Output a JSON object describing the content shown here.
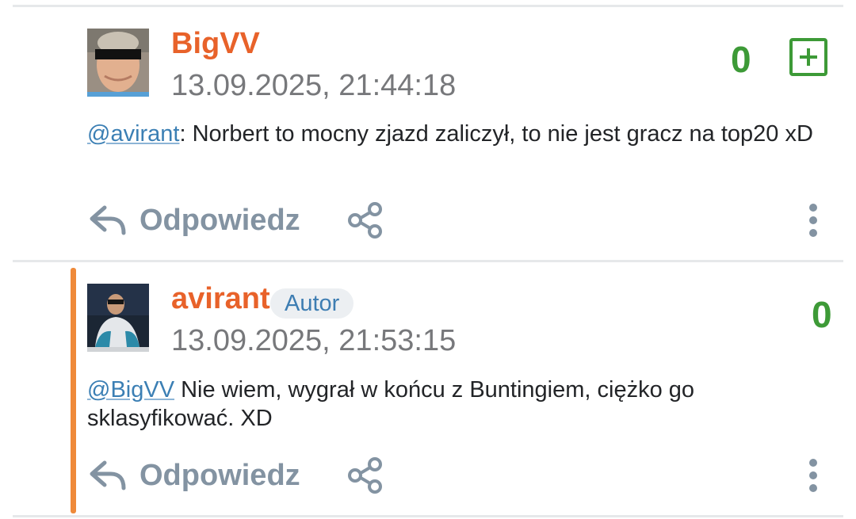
{
  "comments": [
    {
      "username": "BigVV",
      "timestamp": "13.09.2025, 21:44:18",
      "score": "0",
      "mention": "@avirant",
      "text": ": Norbert to mocny zjazd zaliczył, to nie jest gracz na top20 xD",
      "reply_label": "Odpowiedz"
    },
    {
      "username": "avirant",
      "badge": "Autor",
      "timestamp": "13.09.2025, 21:53:15",
      "score": "0",
      "mention": "@BigVV",
      "text": " Nie wiem, wygrał w końcu z Buntingiem, ciężko go sklasyfikować. XD",
      "reply_label": "Odpowiedz"
    }
  ],
  "icons": {
    "reply": "reply-arrow-icon",
    "share": "share-icon",
    "more": "more-vertical-icon",
    "upvote": "plus-square-icon"
  },
  "colors": {
    "username": "#e8622a",
    "score": "#3d9a37",
    "link": "#3b7fb4",
    "action": "#8393a2",
    "author_accent": "#ef8a3a",
    "badge_text": "#3d7db2"
  }
}
